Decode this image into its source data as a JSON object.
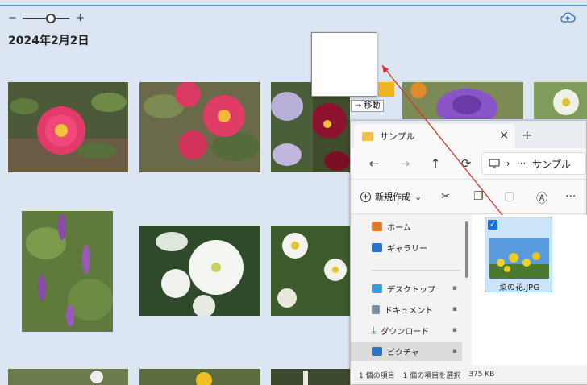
{
  "gallery": {
    "zoom_minus": "−",
    "zoom_plus": "+",
    "zoom_level": 0.6,
    "date_heading": "2024年2月2日",
    "cloud_icon": "cloud-upload-icon"
  },
  "drag": {
    "move_arrow": "→",
    "move_label": "移動"
  },
  "explorer": {
    "tab_title": "サンプル",
    "tab_close": "×",
    "new_tab": "+",
    "nav": {
      "back": "←",
      "forward": "→",
      "up": "↑",
      "refresh": "⟳"
    },
    "address": {
      "sep1": "›",
      "more": "···",
      "folder": "サンプル"
    },
    "toolbar": {
      "new_label": "新規作成",
      "new_chevron": "⌄",
      "more": "···"
    },
    "sidebar": {
      "items": [
        {
          "label": "ホーム",
          "icon": "home-icon",
          "pinned": false
        },
        {
          "label": "ギャラリー",
          "icon": "gallery-icon",
          "pinned": false
        },
        {
          "label": "デスクトップ",
          "icon": "desktop-icon",
          "pinned": true
        },
        {
          "label": "ドキュメント",
          "icon": "document-icon",
          "pinned": true
        },
        {
          "label": "ダウンロード",
          "icon": "download-icon",
          "pinned": true
        },
        {
          "label": "ピクチャ",
          "icon": "pictures-icon",
          "pinned": true,
          "selected": true
        }
      ],
      "pin_glyph": "📌"
    },
    "file": {
      "name": "菜の花.JPG",
      "checked": true
    },
    "status": {
      "count": "1 個の項目",
      "selected": "1 個の項目を選択",
      "size": "375 KB"
    }
  },
  "colors": {
    "background": "#dce6f2",
    "accent": "#5b8fc7",
    "selection": "#cce4f7",
    "drag_line": "#d9342b"
  }
}
